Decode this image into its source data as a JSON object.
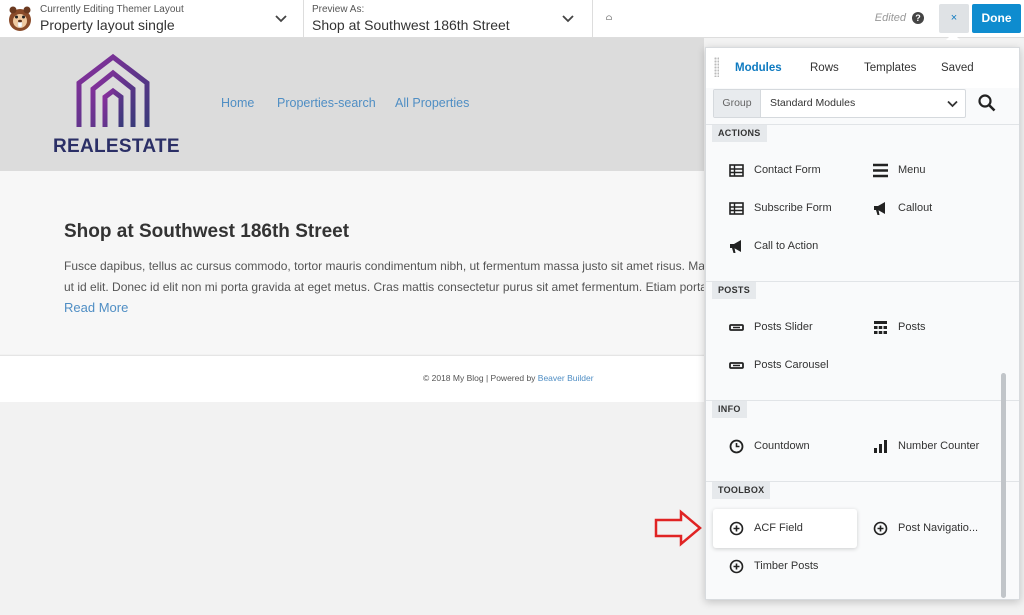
{
  "toolbar": {
    "editing_label": "Currently Editing Themer Layout",
    "editing_value": "Property layout single",
    "preview_label": "Preview As:",
    "preview_value": "Shop at Southwest 186th Street",
    "edited_status": "Edited",
    "help_glyph": "?",
    "close_glyph": "×",
    "done_label": "Done",
    "accent_color": "#0e8ccf"
  },
  "site": {
    "brand_name": "REALESTATE",
    "brand_color": "#2b2f66",
    "nav": [
      "Home",
      "Properties-search",
      "All Properties"
    ],
    "post_title": "Shop at Southwest 186th Street",
    "excerpt_line1": "Fusce dapibus, tellus ac cursus commodo, tortor mauris condimentum nibh, ut fermentum massa justo sit amet risus. Maecenas",
    "excerpt_line2": "ut id elit. Donec id elit non mi porta gravida at eget metus. Cras mattis consectetur purus sit amet fermentum. Etiam porta sem",
    "read_more": "Read More",
    "footer_prefix": "© 2018 My Blog | Powered by ",
    "footer_link": "Beaver Builder"
  },
  "panel": {
    "tabs": [
      "Modules",
      "Rows",
      "Templates",
      "Saved"
    ],
    "active_tab": "Modules",
    "group_label": "Group",
    "group_value": "Standard Modules",
    "sections": [
      {
        "label": "ACTIONS",
        "modules": [
          {
            "label": "Contact Form",
            "icon": "table-icon"
          },
          {
            "label": "Menu",
            "icon": "menu-icon"
          },
          {
            "label": "Subscribe Form",
            "icon": "table-icon"
          },
          {
            "label": "Callout",
            "icon": "megaphone-icon"
          },
          {
            "label": "Call to Action",
            "icon": "megaphone-icon"
          }
        ]
      },
      {
        "label": "POSTS",
        "modules": [
          {
            "label": "Posts Slider",
            "icon": "slider-icon"
          },
          {
            "label": "Posts",
            "icon": "grid-icon"
          },
          {
            "label": "Posts Carousel",
            "icon": "slider-icon"
          }
        ]
      },
      {
        "label": "INFO",
        "modules": [
          {
            "label": "Countdown",
            "icon": "clock-icon"
          },
          {
            "label": "Number Counter",
            "icon": "bar-chart-icon"
          }
        ]
      },
      {
        "label": "TOOLBOX",
        "modules": [
          {
            "label": "ACF Field",
            "icon": "plus-circle-icon"
          },
          {
            "label": "Post Navigatio...",
            "icon": "plus-circle-icon"
          },
          {
            "label": "Timber Posts",
            "icon": "plus-circle-icon"
          }
        ]
      }
    ]
  }
}
